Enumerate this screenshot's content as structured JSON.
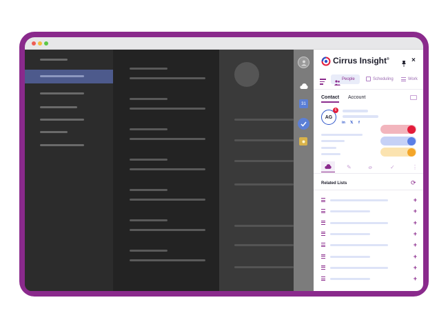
{
  "app": {
    "brand": "Cirrus Insight",
    "trademark": "®",
    "brand_color": "#8a2a8c",
    "accent_blue": "#4169e1",
    "accent_red": "#e31b3a"
  },
  "titlebar": {
    "dots": [
      "#ee5e55",
      "#f5bc3b",
      "#5dc746"
    ]
  },
  "panel": {
    "header": {
      "pin_icon": "pin-icon",
      "close_icon": "close-icon"
    },
    "nav": {
      "menu_icon": "hamburger-menu-icon",
      "tabs": [
        {
          "label": "People",
          "icon": "people-icon",
          "active": true
        },
        {
          "label": "Scheduling",
          "icon": "calendar-icon",
          "active": false
        },
        {
          "label": "Work",
          "icon": "list-icon",
          "active": false
        }
      ]
    },
    "contact_tabs": [
      {
        "label": "Contact",
        "active": true
      },
      {
        "label": "Account",
        "active": false
      }
    ],
    "contact": {
      "initials": "AG",
      "badge": "6",
      "socials": [
        "in",
        "𝕏",
        "f"
      ]
    },
    "actions": [
      "cloud-icon",
      "edit-icon",
      "attach-icon",
      "check-icon",
      "more-icon"
    ],
    "related_lists": {
      "title": "Related Lists",
      "refresh_icon": "refresh-icon",
      "count": 8
    }
  }
}
